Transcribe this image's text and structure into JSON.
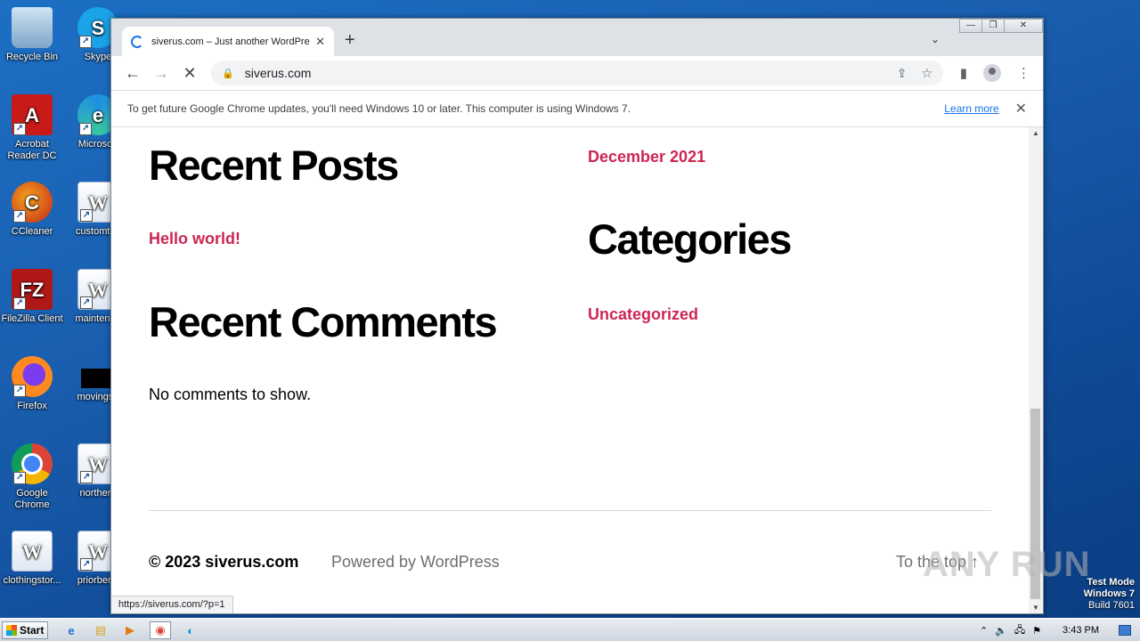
{
  "desktop": {
    "icons": [
      {
        "label": "Recycle Bin",
        "glyph": "",
        "icon": "recycle-bin-icon"
      },
      {
        "label": "Skype",
        "glyph": "S",
        "icon": "skype-icon"
      },
      {
        "label": "Acrobat Reader DC",
        "glyph": "A",
        "icon": "acrobat-icon"
      },
      {
        "label": "Microsoft",
        "glyph": "e",
        "icon": "edge-icon"
      },
      {
        "label": "CCleaner",
        "glyph": "C",
        "icon": "ccleaner-icon"
      },
      {
        "label": "customtes",
        "glyph": "W",
        "icon": "word-document-icon"
      },
      {
        "label": "FileZilla Client",
        "glyph": "FZ",
        "icon": "filezilla-icon"
      },
      {
        "label": "maintenan",
        "glyph": "W",
        "icon": "word-document-icon"
      },
      {
        "label": "Firefox",
        "glyph": "",
        "icon": "firefox-icon"
      },
      {
        "label": "movingsu",
        "glyph": "",
        "icon": "black-file-icon"
      },
      {
        "label": "Google Chrome",
        "glyph": "",
        "icon": "chrome-icon"
      },
      {
        "label": "northern",
        "glyph": "W",
        "icon": "word-document-icon"
      },
      {
        "label": "clothingstor...",
        "glyph": "W",
        "icon": "word-document-icon"
      },
      {
        "label": "priorbene",
        "glyph": "W",
        "icon": "word-document-icon"
      }
    ]
  },
  "browser": {
    "tab_title": "siverus.com – Just another WordPre",
    "tab_close": "✕",
    "new_tab": "+",
    "tab_search": "⌄",
    "win_controls": {
      "minimize": "—",
      "restore": "❐",
      "close": "✕"
    },
    "nav": {
      "back": "←",
      "forward": "→",
      "stop": "✕"
    },
    "url": "siverus.com",
    "lock": "🔒",
    "omnibox_icons": {
      "share": "⇪",
      "star": "☆"
    },
    "toolbar_icons": {
      "sidepanel": "▮",
      "menu": "⋮"
    },
    "infobar": {
      "message": "To get future Google Chrome updates, you'll need Windows 10 or later. This computer is using Windows 7.",
      "learn_more": "Learn more",
      "close": "✕"
    },
    "status_url": "https://siverus.com/?p=1"
  },
  "page": {
    "recent_posts_heading": "Recent Posts",
    "recent_posts": [
      "Hello world!"
    ],
    "recent_comments_heading": "Recent Comments",
    "no_comments": "No comments to show.",
    "archive_link": "December 2021",
    "categories_heading": "Categories",
    "categories": [
      "Uncategorized"
    ],
    "footer": {
      "copyright": "© 2023 siverus.com",
      "powered": "Powered by WordPress",
      "to_top": "To the top ↑"
    },
    "link_color": "#cd2653"
  },
  "scrollbar": {
    "up": "▲",
    "down": "▼"
  },
  "watermark": {
    "text": "ANY RUN",
    "line1": "Test Mode",
    "line2": "Windows 7",
    "line3": "Build 7601"
  },
  "taskbar": {
    "start_label": "Start",
    "apps": [
      {
        "glyph": "e",
        "icon": "internet-explorer-icon"
      },
      {
        "glyph": "▤",
        "icon": "explorer-folder-icon"
      },
      {
        "glyph": "▶",
        "icon": "media-player-icon"
      },
      {
        "glyph": "◉",
        "icon": "chrome-taskbar-icon"
      },
      {
        "glyph": "◐",
        "icon": "edge-taskbar-icon"
      }
    ],
    "tray": {
      "chevron": "⌃",
      "volume": "🔈",
      "network": "🖧",
      "flag": "⚑",
      "clock": "3:43 PM"
    }
  }
}
